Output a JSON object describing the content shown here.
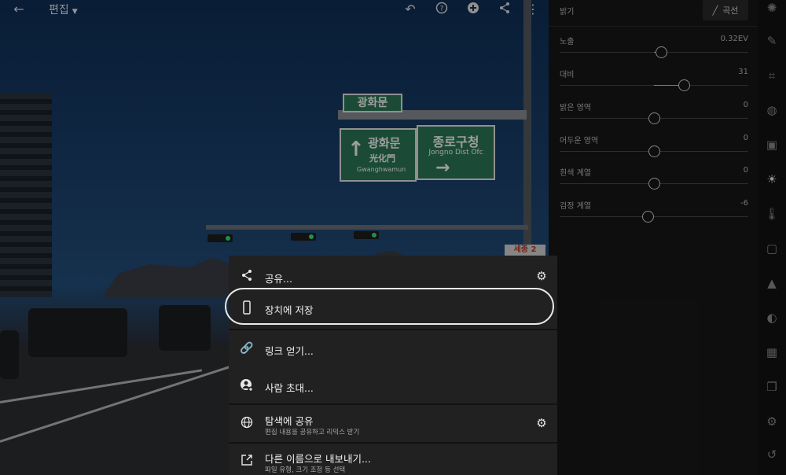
{
  "topbar": {
    "title": "편집",
    "back_icon": "arrow-left-icon",
    "undo_icon": "undo-icon",
    "help_icon": "help-icon",
    "add_icon": "plus-circle-icon",
    "share_icon": "share-icon",
    "more_icon": "more-vertical-icon"
  },
  "photo": {
    "sign_top": "광화문",
    "sign_left_ko": "광화문",
    "sign_left_hanja": "光化門",
    "sign_left_en": "Gwanghwamun",
    "sign_right_ko": "종로구청",
    "sign_right_en": "Jongno Dist Ofc",
    "sign_red": "세종 2"
  },
  "panel": {
    "section_title": "밝기",
    "curve_button": "곡선",
    "sliders": [
      {
        "label": "노출",
        "value": "0.32EV",
        "level": 0.54
      },
      {
        "label": "대비",
        "value": "31",
        "level": 0.66
      },
      {
        "label": "밝은 영역",
        "value": "0",
        "level": 0.5
      },
      {
        "label": "어두운 영역",
        "value": "0",
        "level": 0.5
      },
      {
        "label": "흰색 계열",
        "value": "0",
        "level": 0.5
      },
      {
        "label": "검정 계열",
        "value": "-6",
        "level": 0.47
      }
    ]
  },
  "toolstrip": {
    "tools": [
      {
        "icon": "auto-icon"
      },
      {
        "icon": "brush-icon"
      },
      {
        "icon": "crop-icon"
      },
      {
        "icon": "heal-icon"
      },
      {
        "icon": "profile-icon"
      },
      {
        "icon": "light-icon"
      },
      {
        "icon": "color-icon"
      },
      {
        "icon": "effects-icon"
      },
      {
        "icon": "detail-icon"
      },
      {
        "icon": "optics-icon"
      },
      {
        "icon": "geometry-icon"
      },
      {
        "icon": "versions-icon"
      },
      {
        "icon": "presets-icon"
      },
      {
        "icon": "history-icon"
      }
    ]
  },
  "share_menu": {
    "share": "공유...",
    "save_to_device": "장치에 저장",
    "get_link": "링크 얻기...",
    "invite_people": "사람 초대...",
    "share_to_discover": "탐색에 공유",
    "share_to_discover_sub": "편집 내용을 공유하고 리믹스 받기",
    "export_as": "다른 이름으로 내보내기...",
    "export_as_sub": "파일 유형, 크기 조정 등 선택"
  },
  "colors": {
    "panel_bg": "#181818",
    "menu_bg": "#212121",
    "sign_green": "#2c7a57"
  }
}
